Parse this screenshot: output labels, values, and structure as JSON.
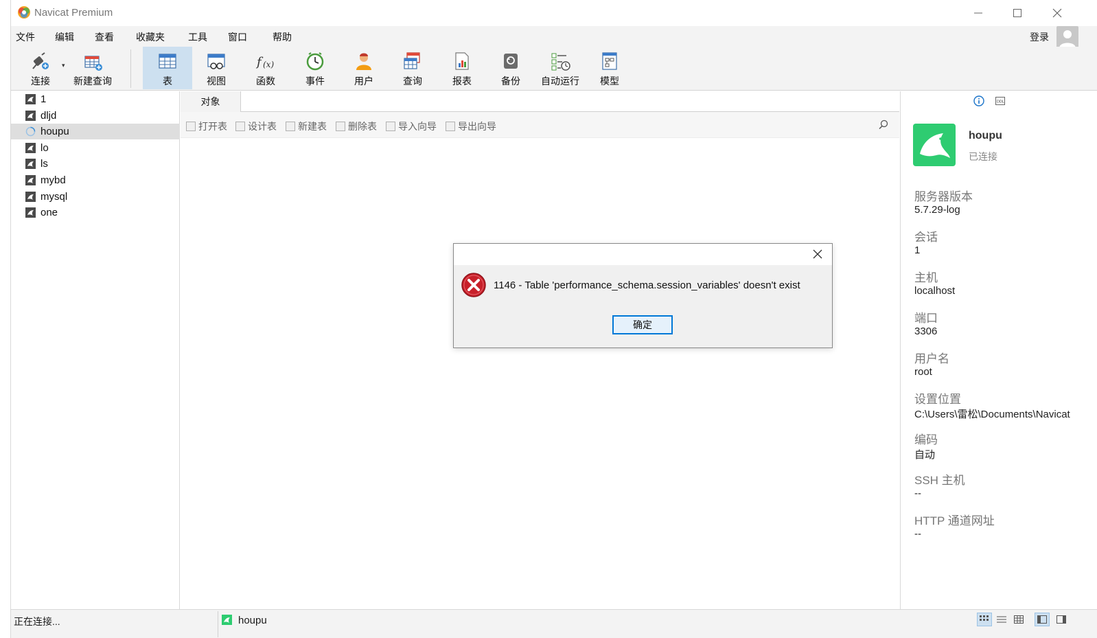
{
  "window": {
    "title": "Navicat Premium"
  },
  "menu": {
    "items": [
      "文件",
      "编辑",
      "查看",
      "收藏夹",
      "工具",
      "窗口",
      "帮助"
    ],
    "login": "登录"
  },
  "toolbar": {
    "connect": "连接",
    "new_query": "新建查询",
    "table": "表",
    "view": "视图",
    "function": "函数",
    "event": "事件",
    "user": "用户",
    "query": "查询",
    "report": "报表",
    "backup": "备份",
    "auto_run": "自动运行",
    "model": "模型"
  },
  "connections": [
    "1",
    "dljd",
    "houpu",
    "lo",
    "ls",
    "mybd",
    "mysql",
    "one"
  ],
  "selected_connection": "houpu",
  "tabs": {
    "objects": "对象"
  },
  "object_toolbar": {
    "open_table": "打开表",
    "design_table": "设计表",
    "new_table": "新建表",
    "delete_table": "删除表",
    "import_wizard": "导入向导",
    "export_wizard": "导出向导"
  },
  "info_panel": {
    "name": "houpu",
    "status": "已连接",
    "fields": [
      {
        "key": "服务器版本",
        "value": "5.7.29-log"
      },
      {
        "key": "会话",
        "value": "1"
      },
      {
        "key": "主机",
        "value": "localhost"
      },
      {
        "key": "端口",
        "value": "3306"
      },
      {
        "key": "用户名",
        "value": "root"
      },
      {
        "key": "设置位置",
        "value": "C:\\Users\\雷松\\Documents\\Navicat"
      },
      {
        "key": "编码",
        "value": "自动"
      },
      {
        "key": "SSH 主机",
        "value": "--"
      },
      {
        "key": "HTTP 通道网址",
        "value": "--"
      }
    ]
  },
  "status_bar": {
    "text": "正在连接...",
    "connection": "houpu"
  },
  "dialog": {
    "message": "1146 - Table 'performance_schema.session_variables' doesn't exist",
    "ok": "确定"
  },
  "colors": {
    "accent": "#0078d7",
    "selection": "#cde0f0",
    "mysql_green": "#2ecc71",
    "error_red": "#c8202a"
  }
}
